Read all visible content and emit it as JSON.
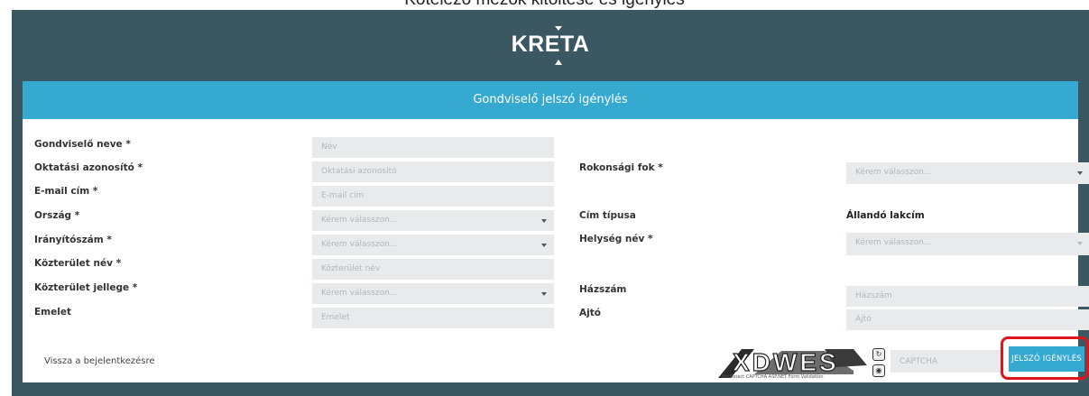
{
  "caption": "Kötelező mezők kitöltése és igénylés",
  "header": {
    "logo_text": "KRETA"
  },
  "banner": {
    "title": "Gondviselő jelszó igénylés"
  },
  "form": {
    "left": [
      {
        "label": "Gondviselő neve *",
        "placeholder": "Név",
        "type": "text"
      },
      {
        "label": "Oktatási azonosító *",
        "placeholder": "Oktatási azonosító",
        "type": "text"
      },
      {
        "label": "E-mail cím *",
        "placeholder": "E-mail cím",
        "type": "text"
      },
      {
        "label": "Ország *",
        "placeholder": "Kérem válasszon...",
        "type": "select"
      },
      {
        "label": "Irányítószám *",
        "placeholder": "Kérem válasszon...",
        "type": "select"
      },
      {
        "label": "Közterület név *",
        "placeholder": "Közterület név",
        "type": "text"
      },
      {
        "label": "Közterület jellege *",
        "placeholder": "Kérem válasszon...",
        "type": "select"
      },
      {
        "label": "Emelet",
        "placeholder": "Emelet",
        "type": "text"
      }
    ],
    "right": {
      "rokonsagi": {
        "label": "Rokonsági fok *",
        "placeholder": "Kérem válasszon..."
      },
      "cim_tipusa": {
        "label": "Cím típusa",
        "value": "Állandó lakcím"
      },
      "helyseg": {
        "label": "Helység név *",
        "placeholder": "Kérem válasszon..."
      },
      "hazszam": {
        "label": "Házszám",
        "placeholder": "Házszám"
      },
      "ajto": {
        "label": "Ajtó",
        "placeholder": "Ajtó"
      }
    }
  },
  "footer": {
    "back_link": "Vissza a bejelentkezésre",
    "captcha_text": "XDWES",
    "captcha_credit": "BotDetect CAPTCHA ASP.NET Form Validation",
    "captcha_placeholder": "CAPTCHA",
    "submit_label": "JELSZÓ IGÉNYLÉS"
  },
  "colors": {
    "frame": "#3b5862",
    "accent": "#36a9d1",
    "highlight": "#e0141b",
    "input_bg": "#e8eaec"
  },
  "icons": [
    "caret-down-icon",
    "refresh-icon",
    "audio-icon"
  ]
}
